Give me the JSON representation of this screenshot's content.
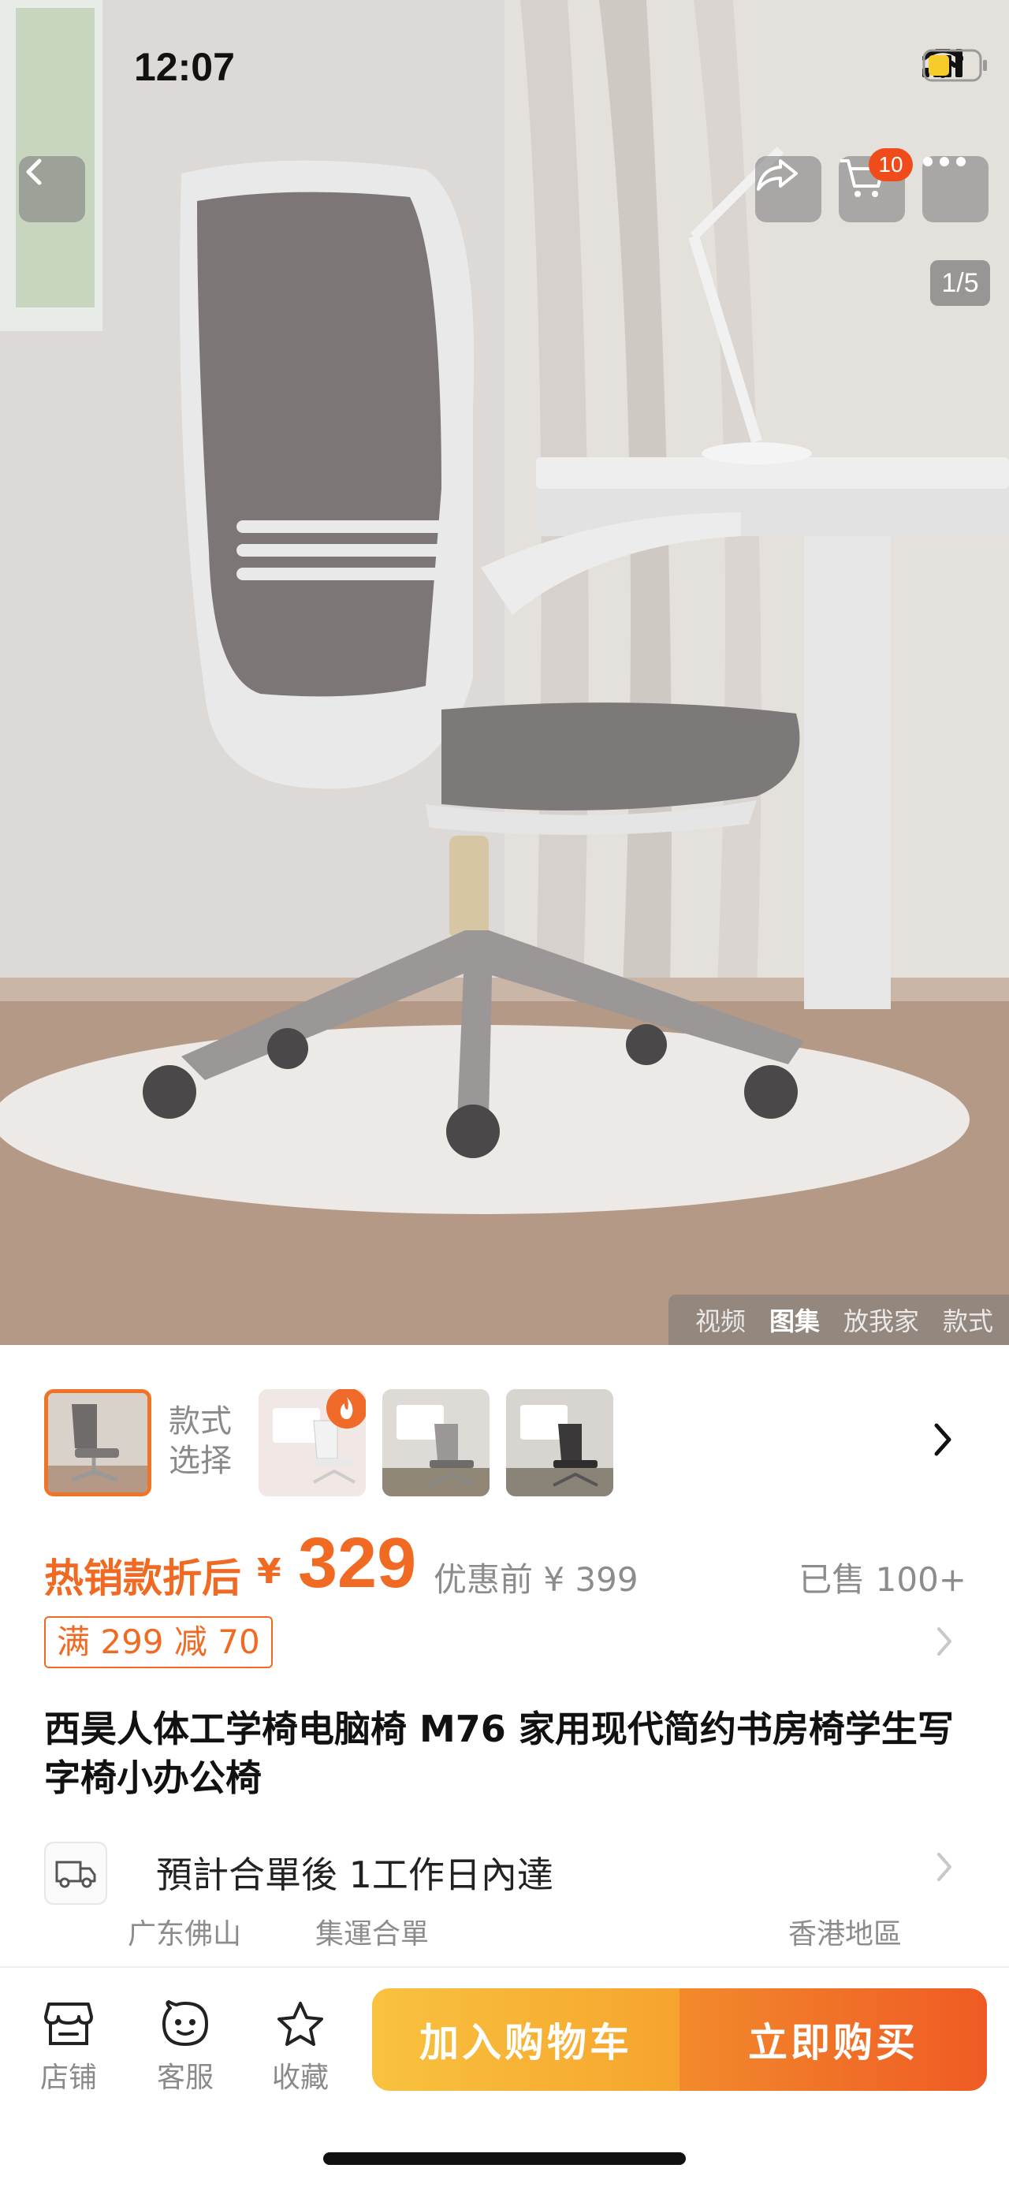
{
  "status_bar": {
    "time": "12:07"
  },
  "hero": {
    "cart_badge": "10",
    "page_indicator": "1/5",
    "media_tabs": [
      {
        "label": "视频",
        "active": false
      },
      {
        "label": "图集",
        "active": true
      },
      {
        "label": "放我家",
        "active": false
      },
      {
        "label": "款式",
        "active": false
      }
    ]
  },
  "style_selector": {
    "label": "款式\n选择"
  },
  "price": {
    "label": "热销款折后",
    "currency": "¥",
    "value": "329",
    "original": "优惠前 ¥ 399",
    "sold": "已售 100+"
  },
  "coupon": {
    "text": "满 299 减 70"
  },
  "product": {
    "title": "西昊人体工学椅电脑椅 M76 家用现代简约书房椅学生写字椅小办公椅"
  },
  "delivery": {
    "text": "預計合單後 1工作日內達",
    "from": "广东佛山",
    "via": "集運合單",
    "to": "香港地區"
  },
  "bottom_bar": {
    "store": "店铺",
    "service": "客服",
    "favorite": "收藏",
    "add_to_cart": "加入购物车",
    "buy_now": "立即购买"
  },
  "colors": {
    "accent": "#f06a23",
    "cart_button": "#f7b536",
    "buy_button": "#ef5a24"
  }
}
